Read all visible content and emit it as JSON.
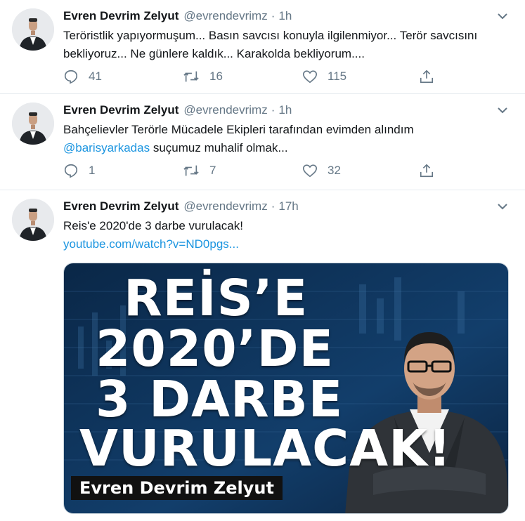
{
  "tweets": [
    {
      "name": "Evren Devrim Zelyut",
      "handle": "@evrendevrimz",
      "separator": "·",
      "time": "1h",
      "text": "Teröristlik yapıyormuşum... Basın savcısı konuyla ilgilenmiyor... Terör savcısını bekliyoruz... Ne günlere kaldık... Karakolda bekliyorum....",
      "replies": "41",
      "retweets": "16",
      "likes": "115"
    },
    {
      "name": "Evren Devrim Zelyut",
      "handle": "@evrendevrimz",
      "separator": "·",
      "time": "1h",
      "text_line1": "Bahçelievler Terörle Mücadele Ekipleri tarafından evimden alındım",
      "mention": "@barisyarkadas",
      "text_after_mention": " suçumuz muhalif olmak...",
      "replies": "1",
      "retweets": "7",
      "likes": "32"
    },
    {
      "name": "Evren Devrim Zelyut",
      "handle": "@evrendevrimz",
      "separator": "·",
      "time": "17h",
      "text": "Reis'e 2020'de 3 darbe vurulacak!",
      "link": "youtube.com/watch?v=ND0pgs...",
      "media": {
        "line1": "REİS’E",
        "line2": "2020’DE",
        "line3": "3 DARBE",
        "line4": "VURULACAK!",
        "caption": "Evren Devrim Zelyut"
      }
    }
  ],
  "icons": [
    "reply-icon",
    "retweet-icon",
    "like-icon",
    "share-icon",
    "caret-down-icon"
  ],
  "colors": {
    "link": "#1b95e0",
    "secondary_text": "#657786",
    "divider": "#e6ecf0",
    "thumbnail_bg": "#0d2a4a"
  }
}
